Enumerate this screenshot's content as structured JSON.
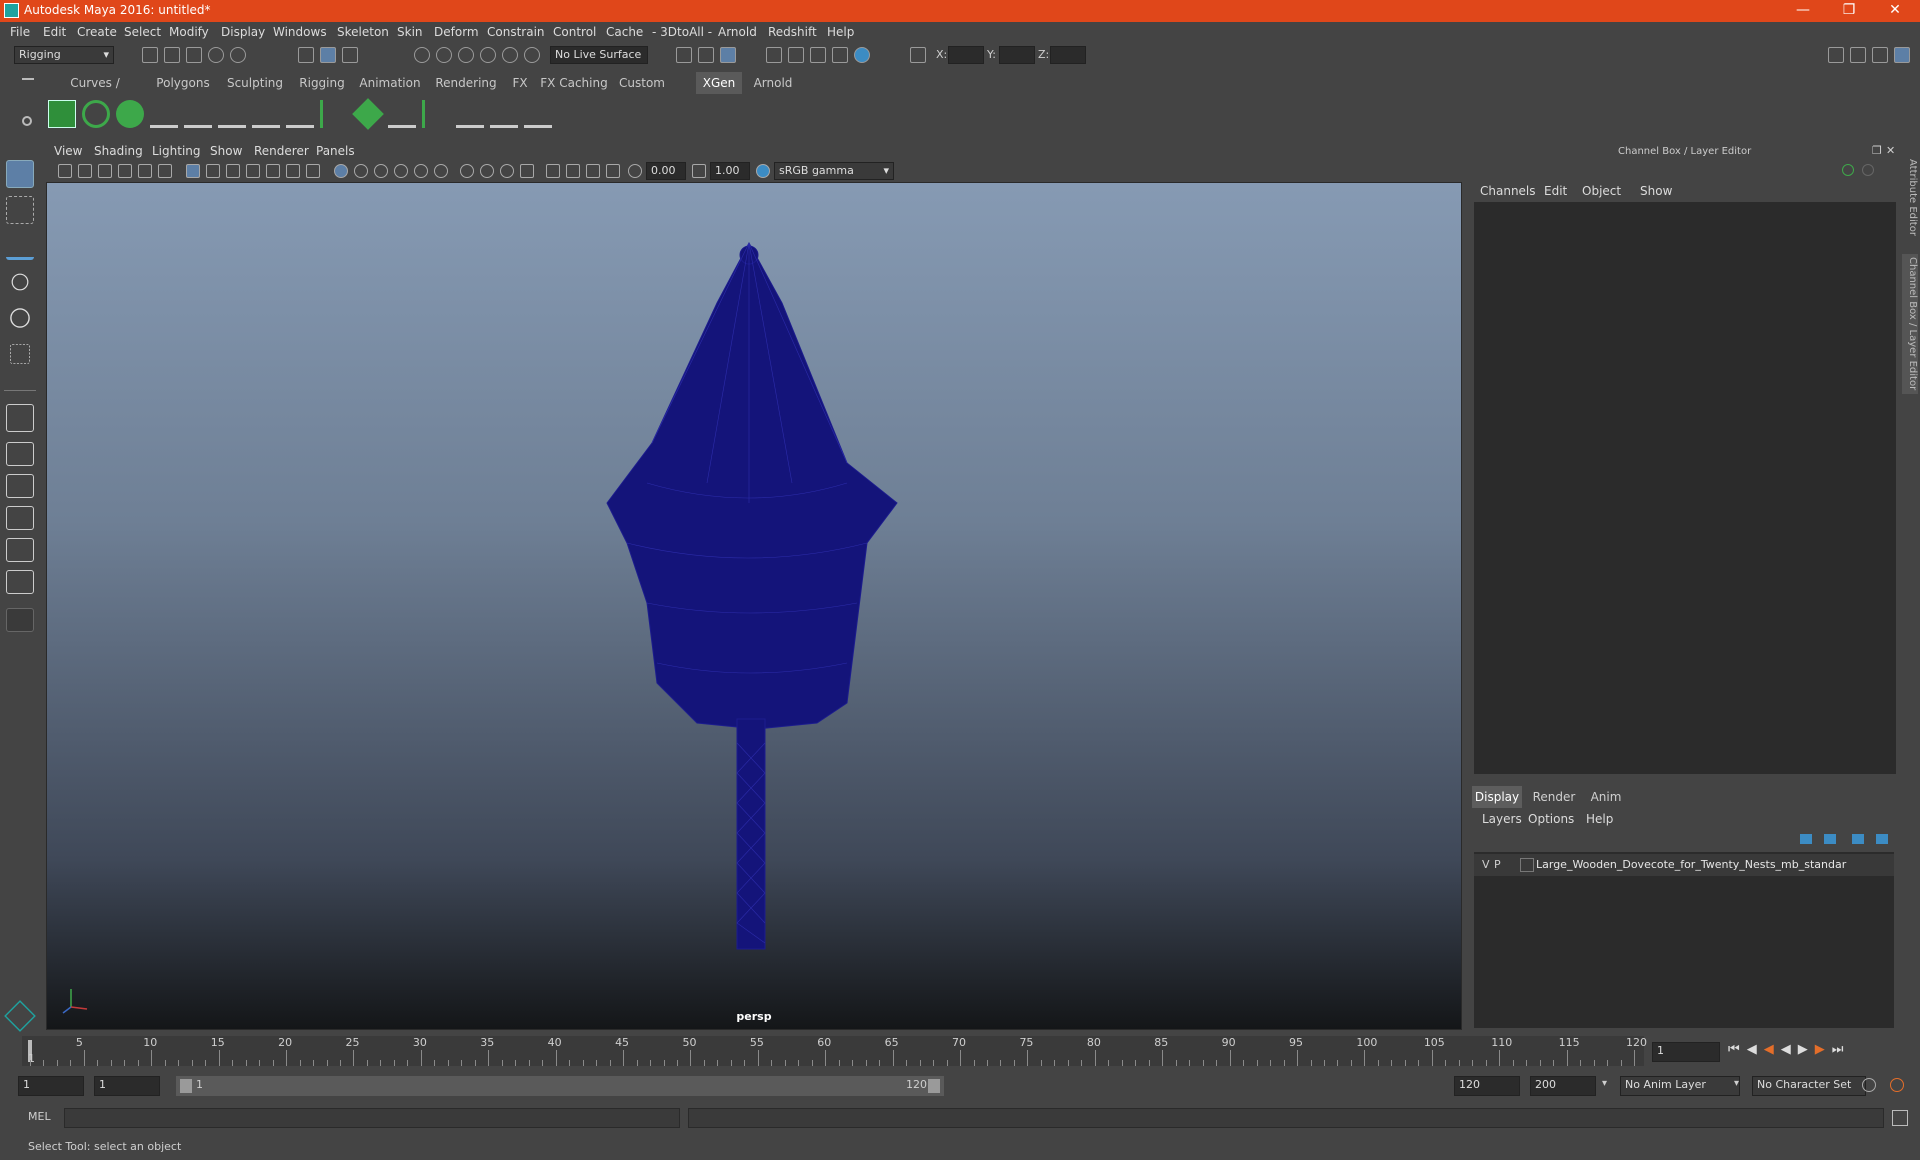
{
  "window": {
    "title": "Autodesk Maya 2016: untitled*"
  },
  "menubar": [
    "File",
    "Edit",
    "Create",
    "Select",
    "Modify",
    "Display",
    "Windows",
    "Skeleton",
    "Skin",
    "Deform",
    "Constrain",
    "Control",
    "Cache",
    "- 3DtoAll -",
    "Arnold",
    "Redshift",
    "Help"
  ],
  "statusline": {
    "mode": "Rigging",
    "live_surface": "No Live Surface",
    "x_label": "X:",
    "y_label": "Y:",
    "z_label": "Z:"
  },
  "shelf_tabs": [
    "Curves / Surfaces",
    "Polygons",
    "Sculpting",
    "Rigging",
    "Animation",
    "Rendering",
    "FX",
    "FX Caching",
    "Custom",
    "XGen",
    "Arnold"
  ],
  "active_shelf_tab": "XGen",
  "panel_menu": [
    "View",
    "Shading",
    "Lighting",
    "Show",
    "Renderer",
    "Panels"
  ],
  "viewport_toolbar": {
    "exposure": "0.00",
    "gamma": "1.00",
    "color_space": "sRGB gamma"
  },
  "viewport": {
    "camera": "persp",
    "wire_color": "#14147a"
  },
  "channel_box": {
    "title": "Channel Box / Layer Editor",
    "menu": [
      "Channels",
      "Edit",
      "Object",
      "Show"
    ]
  },
  "layer_editor": {
    "tabs": [
      "Display",
      "Render",
      "Anim"
    ],
    "active_tab": "Display",
    "menu": [
      "Layers",
      "Options",
      "Help"
    ],
    "layers": [
      {
        "v": "V",
        "p": "P",
        "name": "Large_Wooden_Dovecote_for_Twenty_Nests_mb_standar"
      }
    ]
  },
  "side_tabs": [
    "Attribute Editor",
    "Channel Box / Layer Editor"
  ],
  "time_slider": {
    "ticks": [
      "5",
      "10",
      "15",
      "20",
      "25",
      "30",
      "35",
      "40",
      "45",
      "50",
      "55",
      "60",
      "65",
      "70",
      "75",
      "80",
      "85",
      "90",
      "95",
      "100",
      "105",
      "110",
      "115",
      "120"
    ],
    "current_frame": "1",
    "first_tick_label": "1"
  },
  "range": {
    "start": "1",
    "playback_start": "1",
    "slider_start": "1",
    "slider_end": "120",
    "playback_end": "120",
    "end": "200",
    "anim_layer": "No Anim Layer",
    "character_set": "No Character Set"
  },
  "command_line": {
    "language": "MEL"
  },
  "help_line": "Select Tool: select an object"
}
